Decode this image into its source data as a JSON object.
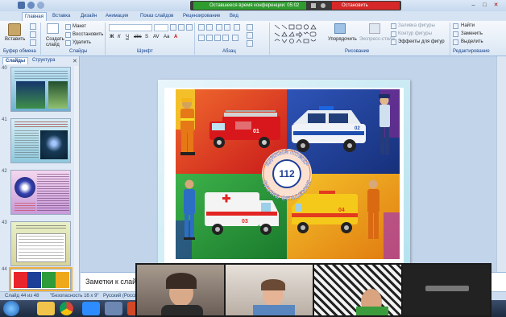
{
  "conference": {
    "timer_text": "Оставшееся время конференции: 05:02",
    "stop_label": "Остановить демонстрацию"
  },
  "ribbon": {
    "tabs": [
      "Главная",
      "Вставка",
      "Дизайн",
      "Анимация",
      "Показ слайдов",
      "Рецензирование",
      "Вид"
    ],
    "clipboard": {
      "paste": "Вставить",
      "group": "Буфер обмена"
    },
    "slides": {
      "create": "Создать слайд",
      "layout": "Макет",
      "reset": "Восстановить",
      "delete": "Удалить",
      "group": "Слайды"
    },
    "font": {
      "group": "Шрифт"
    },
    "paragraph": {
      "group": "Абзац"
    },
    "drawing": {
      "arrange": "Упорядочить",
      "styles": "Экспресс-стили",
      "fill": "Заливка фигуры",
      "outline": "Контур фигуры",
      "effects": "Эффекты для фигур",
      "group": "Рисование"
    },
    "editing": {
      "find": "Найти",
      "replace": "Заменить",
      "select": "Выделить",
      "group": "Редактирование"
    }
  },
  "pane": {
    "tabs": [
      "Слайды",
      "Структура"
    ],
    "thumbnails": [
      {
        "number": "40"
      },
      {
        "number": "41"
      },
      {
        "number": "42"
      },
      {
        "number": "43"
      },
      {
        "number": "44"
      }
    ]
  },
  "slide": {
    "emblem_number": "112",
    "emblem_top_text": "ЕДИНЫЙ НОМЕР",
    "emblem_bottom_text": "СЛУЖБ СПАСЕНИЯ",
    "vehicle_numbers": [
      "01",
      "02",
      "03",
      "04"
    ],
    "colors": {
      "fire": "#e8252b",
      "police": "#1e3f97",
      "ambulance": "#2f9c3b",
      "gas": "#f0a81b"
    }
  },
  "notes": {
    "placeholder": "Заметки к слайду"
  },
  "statusbar": {
    "slide_info": "Слайд 44 из 48",
    "theme": "\"Безопасность 16 х 9\"",
    "language": "Русский (Россия)"
  }
}
